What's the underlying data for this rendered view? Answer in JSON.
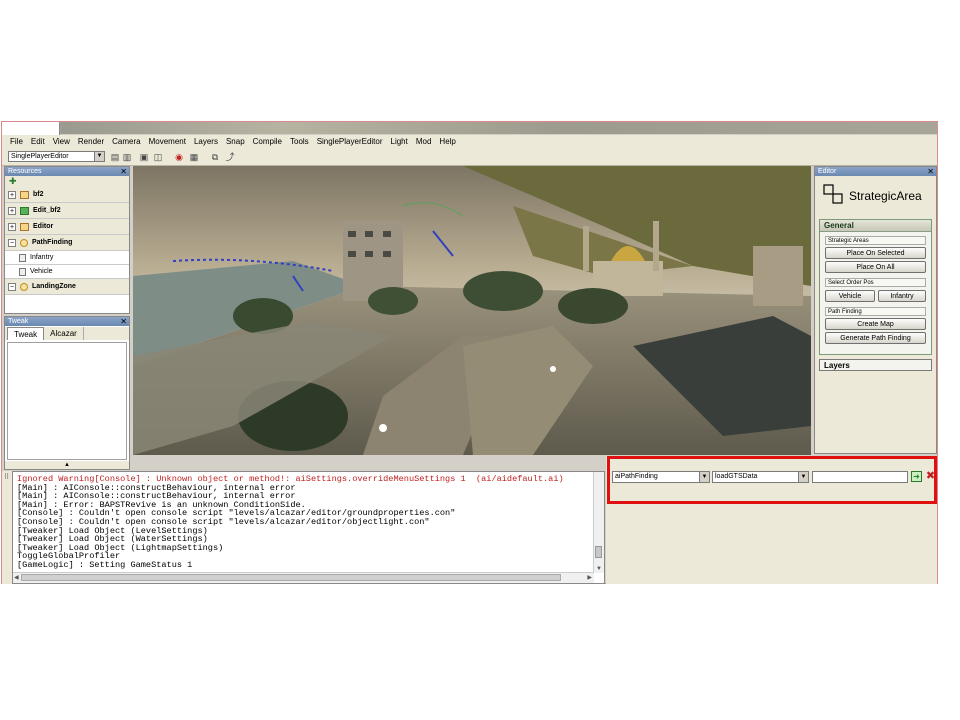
{
  "menu": [
    "File",
    "Edit",
    "View",
    "Render",
    "Camera",
    "Movement",
    "Layers",
    "Snap",
    "Compile",
    "Tools",
    "SinglePlayerEditor",
    "Light",
    "Mod",
    "Help"
  ],
  "toolbar": {
    "editor_mode": "SinglePlayerEditor"
  },
  "resources": {
    "title": "Resources",
    "items": [
      {
        "label": "bf2",
        "icon": "folder-icon",
        "level": 0
      },
      {
        "label": "Edit_bf2",
        "icon": "green-box-icon",
        "level": 0
      },
      {
        "label": "Editor",
        "icon": "folder-icon",
        "level": 0
      },
      {
        "label": "PathFinding",
        "icon": "circle-icon",
        "level": 0
      },
      {
        "label": "Infantry",
        "icon": "doc-icon",
        "level": 1
      },
      {
        "label": "Vehicle",
        "icon": "doc-icon",
        "level": 1
      },
      {
        "label": "LandingZone",
        "icon": "circle-icon",
        "level": 0
      }
    ]
  },
  "tweak": {
    "title": "Tweak",
    "tabs": [
      "Tweak",
      "Alcazar"
    ]
  },
  "editor_panel": {
    "title": "Editor",
    "object_name": "StrategicArea",
    "general_label": "General",
    "groups": {
      "strategic_areas": "Strategic Areas",
      "select_order_pos": "Select Order Pos",
      "path_finding": "Path Finding"
    },
    "buttons": {
      "place_on_selected": "Place On Selected",
      "place_on_all": "Place On All",
      "vehicle": "Vehicle",
      "infantry": "Infantry",
      "create_map": "Create Map",
      "generate_path_finding": "Generate Path Finding"
    },
    "layers_label": "Layers"
  },
  "console": {
    "lines": [
      {
        "text": "Ignored Warning[Console] : Unknown object or method!: aiSettings.overrideMenuSettings 1  (ai/aidefault.ai)",
        "warn": true
      },
      {
        "text": "[Main] : AIConsole::constructBehaviour, internal error",
        "warn": false
      },
      {
        "text": "[Main] : AIConsole::constructBehaviour, internal error",
        "warn": false
      },
      {
        "text": "[Main] : Error: BAPSTRevive is an unknown ConditionSide.",
        "warn": false
      },
      {
        "text": "[Console] : Couldn't open console script \"levels/alcazar/editor/groundproperties.con\"",
        "warn": false
      },
      {
        "text": "[Console] : Couldn't open console script \"levels/alcazar/editor/objectlight.con\"",
        "warn": false
      },
      {
        "text": "[Tweaker] Load Object (LevelSettings)",
        "warn": false
      },
      {
        "text": "[Tweaker] Load Object (WaterSettings)",
        "warn": false
      },
      {
        "text": "[Tweaker] Load Object (LightmapSettings)",
        "warn": false
      },
      {
        "text": "ToggleGlobalProfiler",
        "warn": false
      },
      {
        "text": "[GameLogic] : Setting GameStatus 1",
        "warn": false
      }
    ]
  },
  "command_bar": {
    "object_select": "aiPathFinding",
    "method_select": "loadGTSData",
    "argument_value": ""
  },
  "colors": {
    "highlight": "#e01010",
    "warning_text": "#c02020"
  }
}
